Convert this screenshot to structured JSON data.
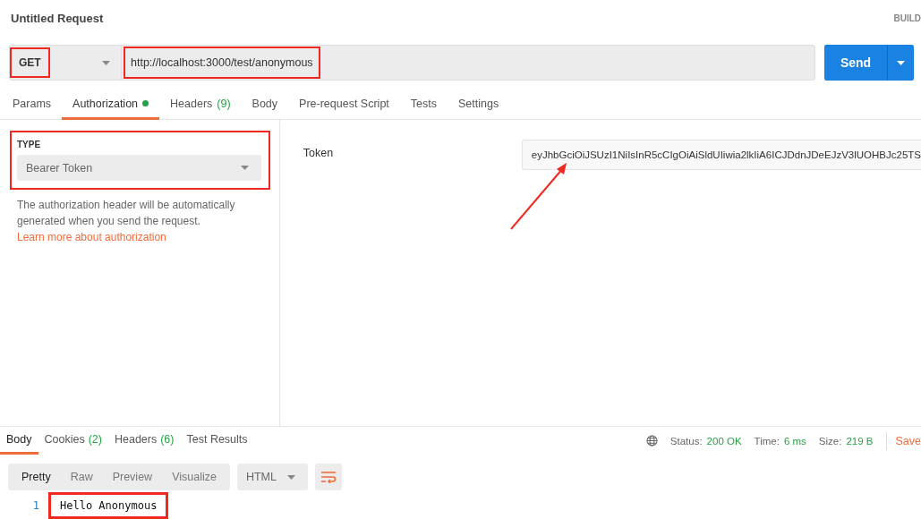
{
  "title": "Untitled Request",
  "build_label": "BUILD",
  "request": {
    "method": "GET",
    "method_highlighted": true,
    "url": "http://localhost:3000/test/anonymous",
    "url_highlighted": true,
    "send": "Send"
  },
  "tabs": [
    {
      "label": "Params",
      "selected": false
    },
    {
      "label": "Authorization",
      "selected": true,
      "dot": true
    },
    {
      "label": "Headers",
      "count": "(9)",
      "selected": false
    },
    {
      "label": "Body",
      "selected": false
    },
    {
      "label": "Pre-request Script",
      "selected": false
    },
    {
      "label": "Tests",
      "selected": false
    },
    {
      "label": "Settings",
      "selected": false
    }
  ],
  "auth": {
    "type_label": "TYPE",
    "type": "Bearer Token",
    "highlighted": true,
    "help": "The authorization header will be automatically generated when you send the request.",
    "help_link": "Learn more about authorization",
    "token_label": "Token",
    "token": "eyJhbGciOiJSUzI1NiIsInR5cCIgOiAiSldUIiwia2lkIiA6ICJDdnJDeEJzV3lUOHBJc25TS",
    "token_arrow": true
  },
  "response_tabs": [
    {
      "label": "Body",
      "selected": true
    },
    {
      "label": "Cookies",
      "count": "(2)",
      "selected": false
    },
    {
      "label": "Headers",
      "count": "(6)",
      "selected": false
    },
    {
      "label": "Test Results",
      "selected": false
    }
  ],
  "status": [
    {
      "label": "Status:",
      "value": "200 OK"
    },
    {
      "label": "Time:",
      "value": "6 ms"
    },
    {
      "label": "Size:",
      "value": "219 B"
    }
  ],
  "save": "Save",
  "view_modes": [
    {
      "label": "Pretty",
      "selected": true
    },
    {
      "label": "Raw",
      "selected": false
    },
    {
      "label": "Preview",
      "selected": false
    },
    {
      "label": "Visualize",
      "selected": false
    }
  ],
  "format": "HTML",
  "body_lines": [
    {
      "number": "1",
      "text": "Hello Anonymous",
      "highlighted": true
    }
  ]
}
